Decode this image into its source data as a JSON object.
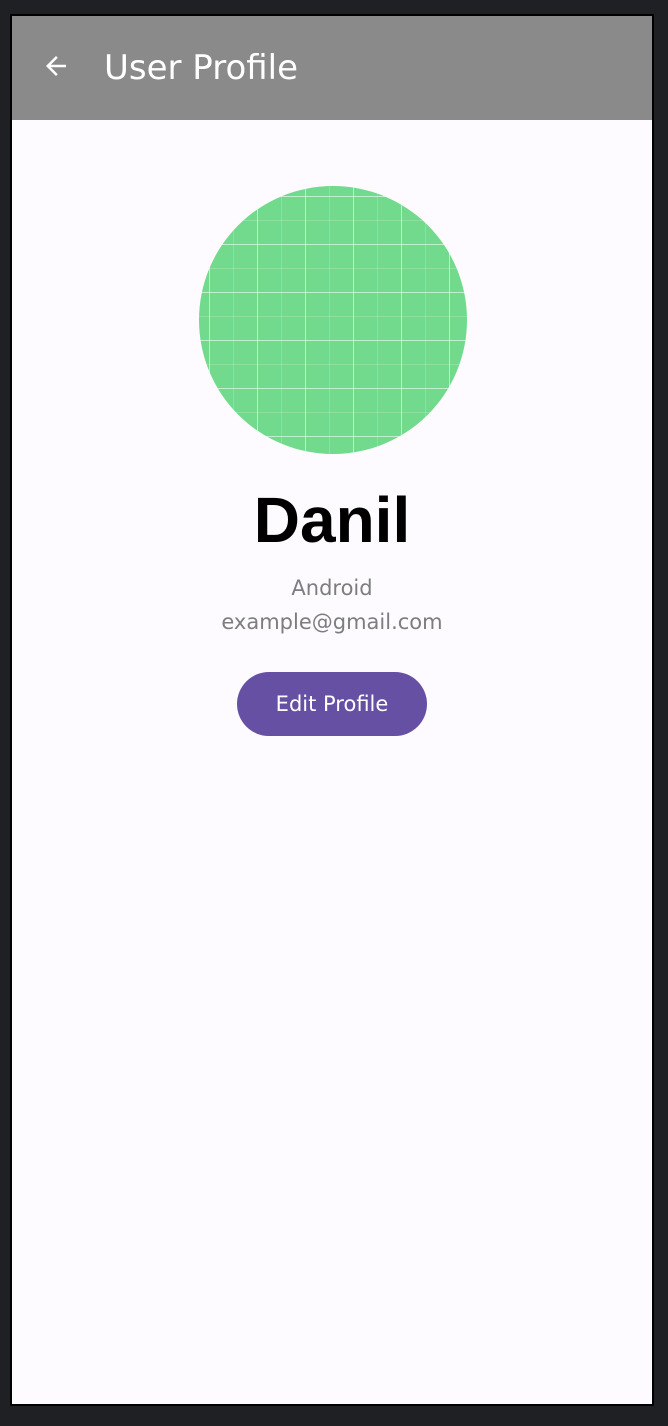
{
  "app_bar": {
    "title": "User Profile",
    "back_icon": "arrow-back-icon",
    "background": "#8a8a8a"
  },
  "profile": {
    "avatar_color": "#72da8d",
    "name": "Danil",
    "role": "Android",
    "email": "example@gmail.com"
  },
  "actions": {
    "edit_label": "Edit Profile",
    "edit_color": "#6650a4"
  }
}
